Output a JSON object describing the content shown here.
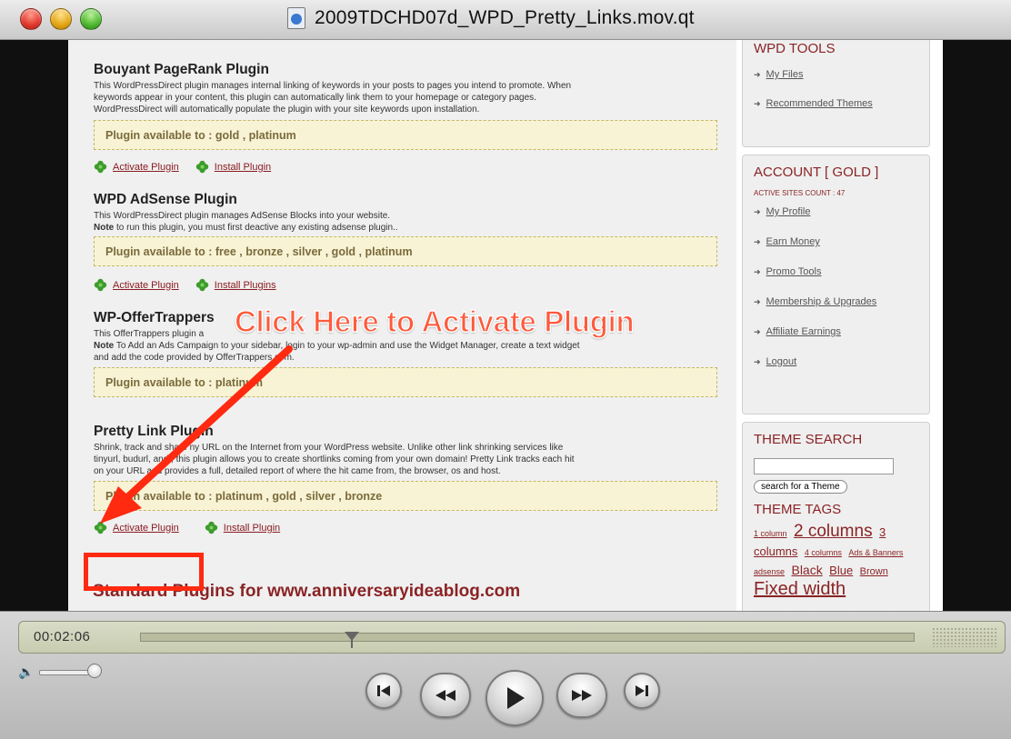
{
  "window": {
    "title": "2009TDCHD07d_WPD_Pretty_Links.mov.qt"
  },
  "plugins": [
    {
      "name": "Bouyant PageRank Plugin",
      "desc_lines": [
        "This WordPressDirect plugin manages internal linking of keywords in your posts to pages you intend to promote. When",
        "keywords appear in your content, this plugin can automatically link them to your homepage or category pages.",
        "WordPressDirect will automatically populate the plugin with your site keywords upon installation."
      ],
      "available": "Plugin available to : gold , platinum",
      "activate": "Activate Plugin",
      "install": "Install Plugin"
    },
    {
      "name": "WPD AdSense Plugin",
      "desc_lines": [
        "This WordPressDirect plugin manages AdSense Blocks into your website.",
        "run this plugin, you must first deactive any existing adsense plugin.."
      ],
      "note_label": "Note",
      "note_prefix": " to ",
      "available": "Plugin available to : free , bronze , silver , gold , platinum",
      "activate": "Activate Plugin",
      "install": "Install Plugins"
    },
    {
      "name": "WP-OfferTrappers",
      "desc_lines": [
        "This OfferTrappers plugin a",
        "To Add an Ads Campaign to your sidebar, login to your wp-admin and use the Widget Manager, create a text widget",
        "and add the code provided by OfferTrappers.com."
      ],
      "note_label": "Note",
      "available": "Plugin available to : platinum"
    },
    {
      "name": "Pretty Link Plugin",
      "desc_lines": [
        "Shrink, track and share    ny URL on the Internet from your WordPress website. Unlike other link shrinking services like",
        "tinyurl, budurl, and     , this plugin allows you to create shortlinks coming from your own domain! Pretty Link tracks each hit",
        "on your URL and provides a full, detailed report of where the hit came from, the browser, os and host."
      ],
      "available": "Plugin available to : platinum , gold , silver , bronze",
      "activate": "Activate Plugin",
      "install": "Install Plugin"
    }
  ],
  "standard_heading": "Standard Plugins for www.anniversaryideablog.com",
  "sidebar": {
    "tools_title": "WPD TOOLS",
    "tools_links": [
      "My Files",
      "Recommended Themes"
    ],
    "account_title": "ACCOUNT [ GOLD ]",
    "active_sites": "ACTIVE SITES COUNT : 47",
    "account_links": [
      "My Profile",
      "Earn Money",
      "Promo Tools",
      "Membership & Upgrades",
      "Affiliate Earnings",
      "Logout"
    ],
    "search_title": "THEME SEARCH",
    "search_placeholder": "",
    "search_button": "search for a Theme",
    "tags_title": "THEME TAGS",
    "tags": [
      {
        "text": "1 column",
        "size": 9
      },
      {
        "text": "2 columns",
        "size": 19
      },
      {
        "text": "3",
        "size": 13
      },
      {
        "text": "columns",
        "size": 13
      },
      {
        "text": "4 columns",
        "size": 9
      },
      {
        "text": "Ads & Banners",
        "size": 9
      },
      {
        "text": "adsense",
        "size": 9
      },
      {
        "text": "Black",
        "size": 14
      },
      {
        "text": "Blue",
        "size": 13
      },
      {
        "text": "Brown",
        "size": 11
      },
      {
        "text": "Fixed width",
        "size": 20
      }
    ]
  },
  "annotation": {
    "callout": "Click Here to Activate Plugin"
  },
  "player": {
    "timecode": "00:02:06",
    "progress": 0.27,
    "volume": 1.0
  },
  "colors": {
    "accent_red": "#8a2325",
    "callout": "#ff5a3c",
    "highlight_box": "#ff2a10"
  }
}
